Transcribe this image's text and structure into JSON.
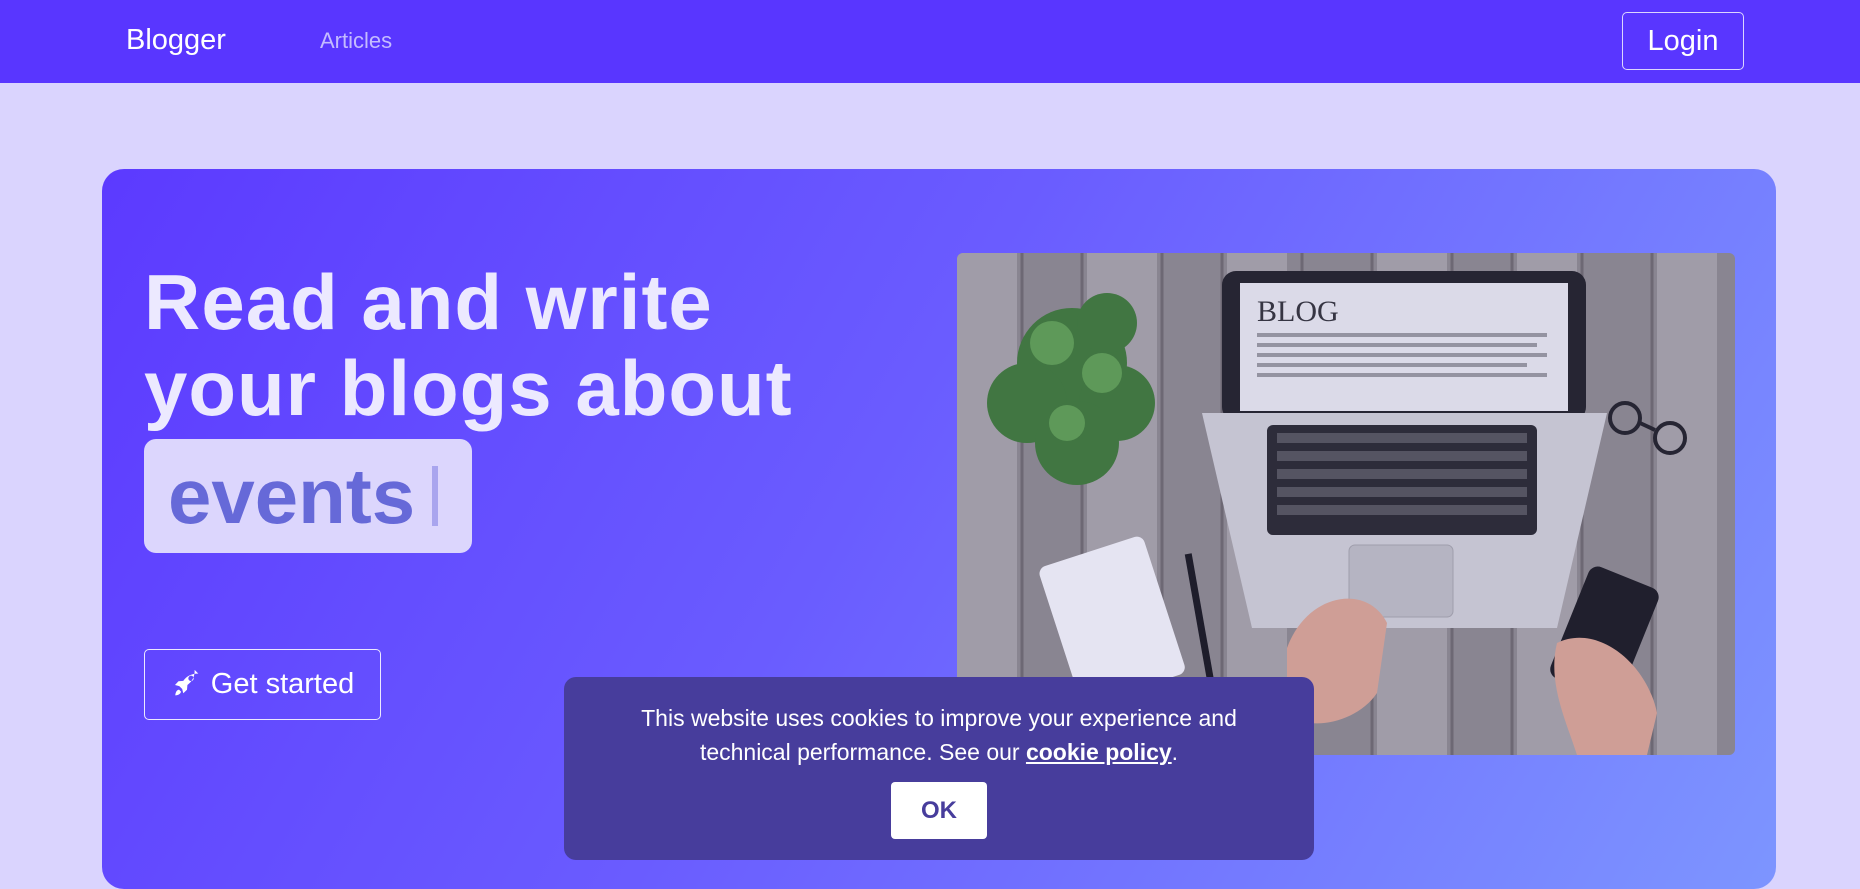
{
  "navbar": {
    "brand": "Blogger",
    "links": [
      {
        "label": "Articles"
      }
    ],
    "login_label": "Login"
  },
  "hero": {
    "headline_line1": "Read and write",
    "headline_line2": "your blogs about",
    "typed_word": "events",
    "cta_label": "Get started",
    "cta_icon": "rocket-icon",
    "image_text": "BLOG"
  },
  "cookie_banner": {
    "text_before": "This website uses cookies to improve your experience and technical performance. See our ",
    "link_text": "cookie policy",
    "text_after": ".",
    "ok_label": "OK"
  },
  "colors": {
    "navbar": "#5936ff",
    "page_background": "#dad4fe",
    "hero_gradient_start": "#5c3aff",
    "hero_gradient_end": "#7d95ff",
    "cookie_banner": "#473d9c"
  }
}
